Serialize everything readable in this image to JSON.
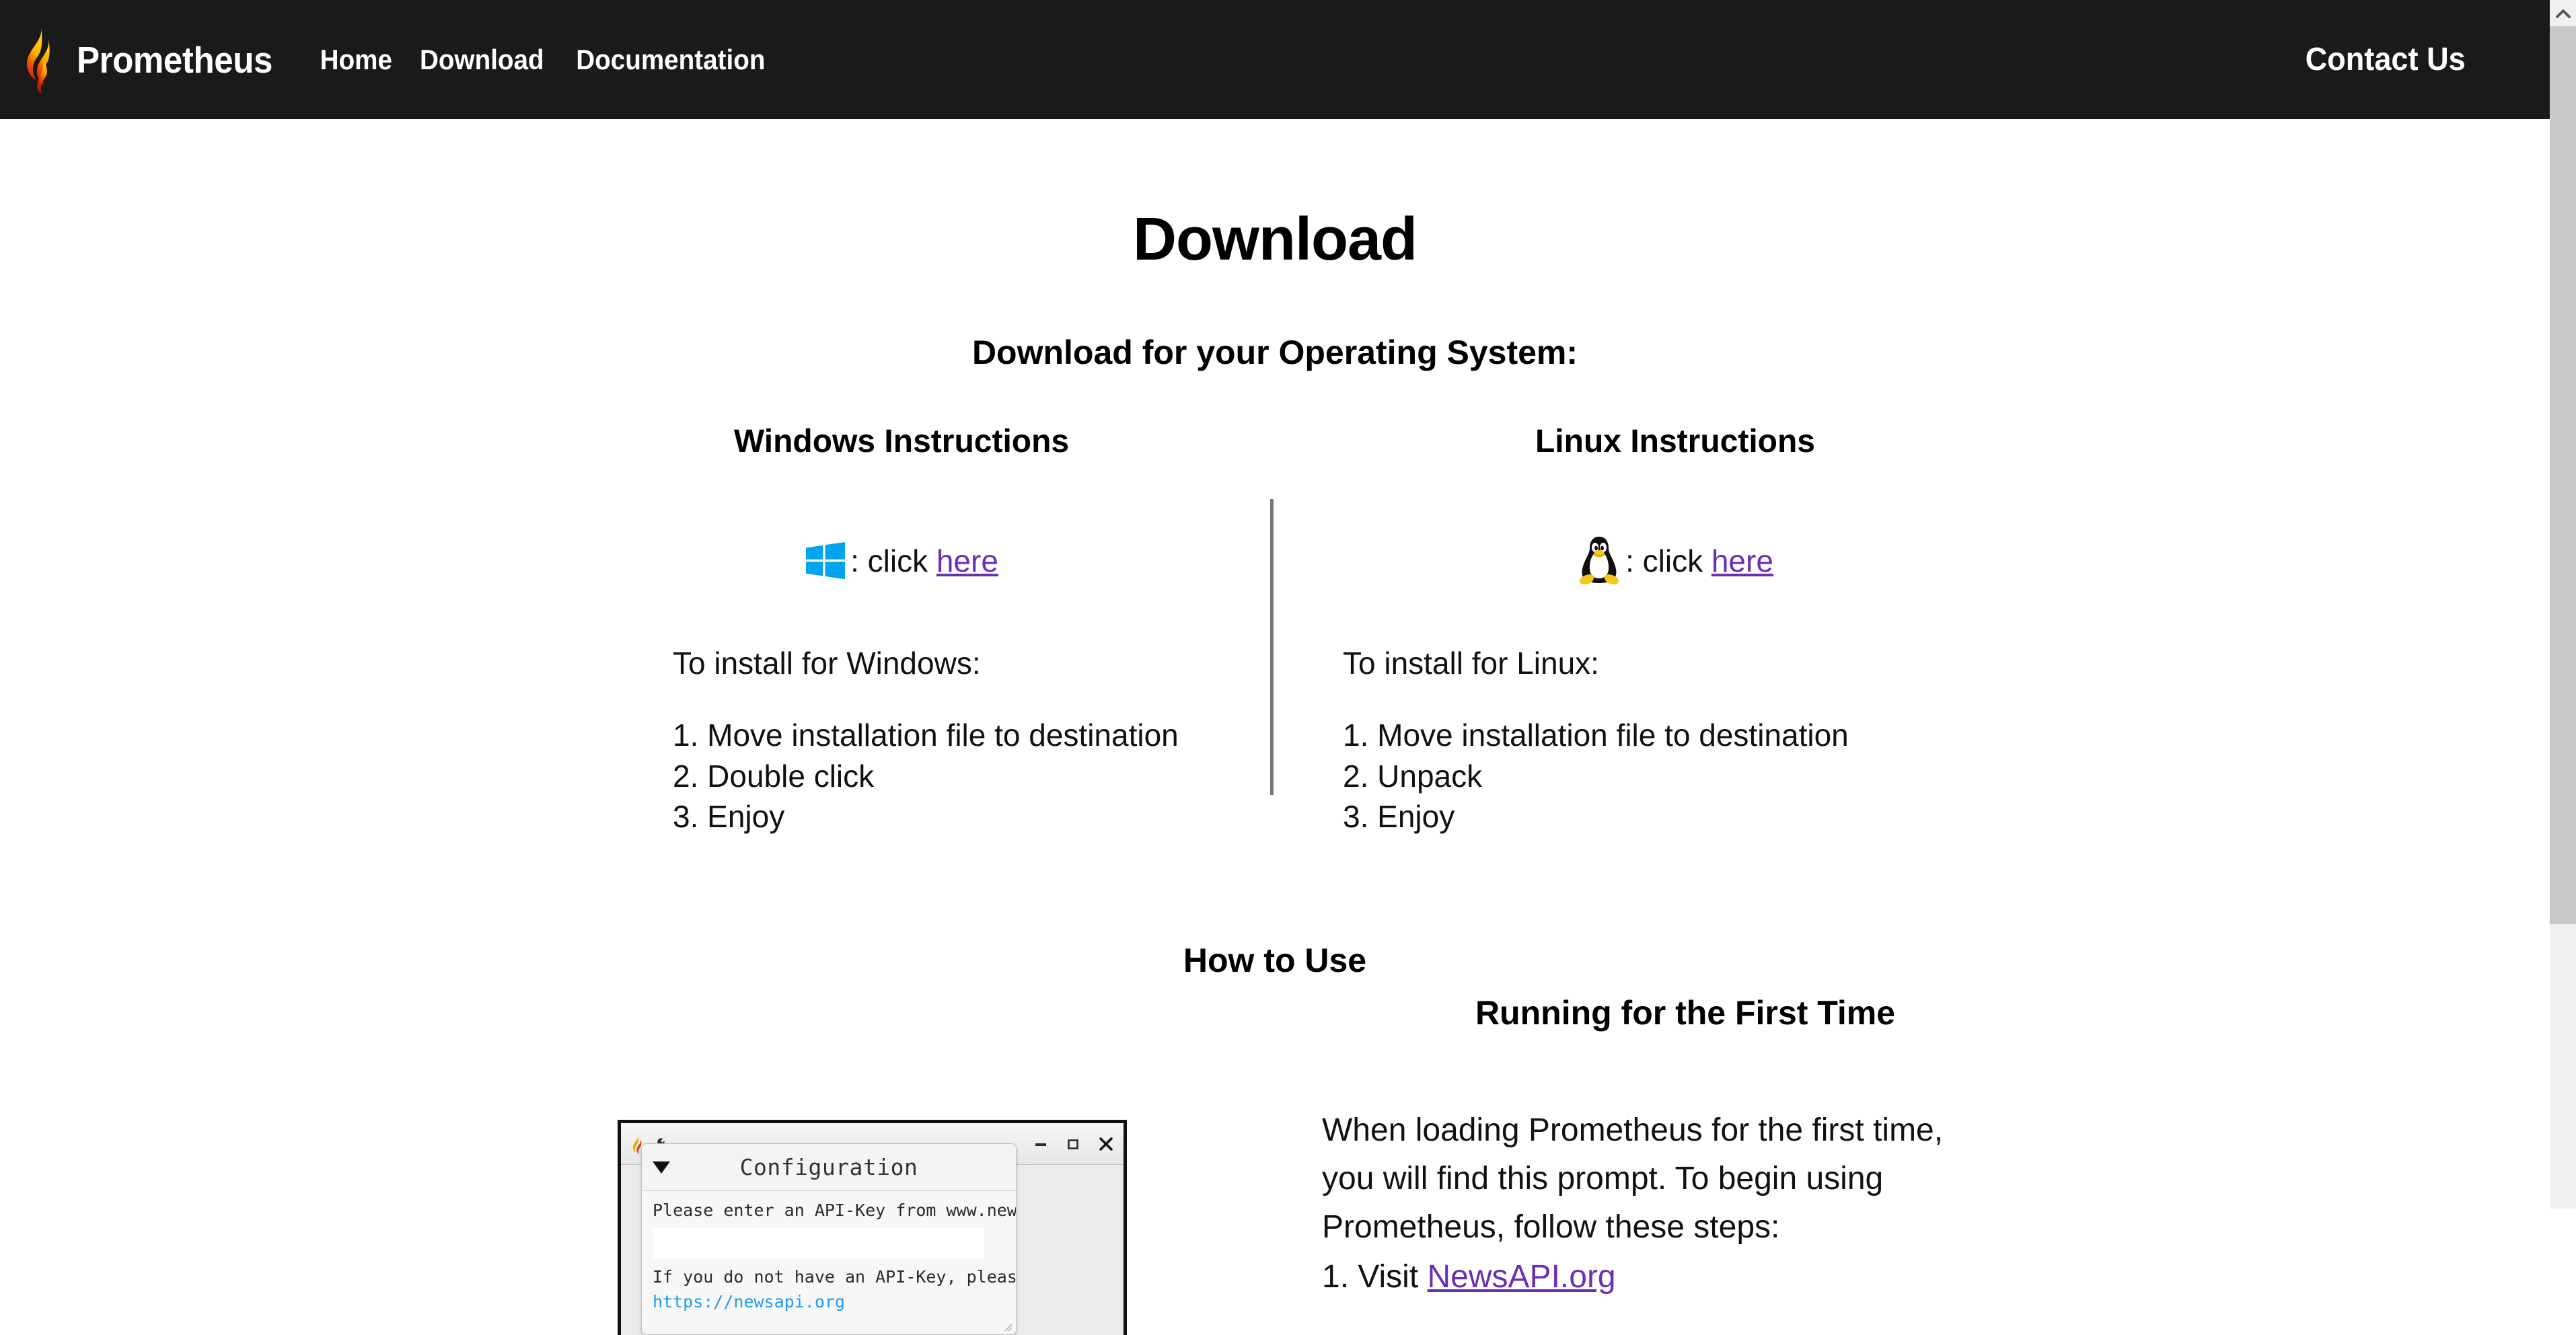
{
  "header": {
    "brand": "Prometheus",
    "logo_icon": "prometheus-flame-icon",
    "nav": [
      {
        "label": "Home"
      },
      {
        "label": "Download"
      },
      {
        "label": "Documentation"
      }
    ],
    "contact": "Contact Us"
  },
  "scrollbar": {
    "up_arrow_icon": "chevron-up-icon"
  },
  "page": {
    "title": "Download",
    "os_subtitle": "Download for your Operating System:"
  },
  "windows": {
    "heading": "Windows Instructions",
    "icon": "windows-logo-icon",
    "click_prefix": ": click ",
    "click_link": "here",
    "lead": "To install for Windows:",
    "steps": [
      "1. Move installation file to destination",
      "2. Double click",
      "3. Enjoy"
    ]
  },
  "linux": {
    "heading": "Linux Instructions",
    "icon": "linux-tux-penguin-icon",
    "click_prefix": ": click ",
    "click_link": "here",
    "lead": "To install for Linux:",
    "steps": [
      "1. Move installation file to destination",
      "2. Unpack",
      "3. Enjoy"
    ]
  },
  "howto": {
    "heading": "How to Use"
  },
  "app_window": {
    "app_icon": "prometheus-flame-icon",
    "tool_icon": "wrench-icon",
    "minimize_icon": "minimize-icon",
    "maximize_icon": "maximize-icon",
    "close_icon": "close-icon",
    "dialog": {
      "menu_arrow_icon": "caret-down-icon",
      "title": "Configuration",
      "prompt": "Please enter an API-Key from www.newsapi.org",
      "apikey_value": "",
      "apikey_placeholder": "",
      "secondary_text": "If you do not have an API-Key, please visit",
      "url_text": "https://newsapi.org",
      "resize_grip_icon": "resize-grip-icon"
    }
  },
  "firstrun": {
    "heading": "Running for the First Time",
    "paragraph_lines": [
      "When loading Prometheus for the first time,",
      "you will find this prompt.  To begin using",
      "Prometheus, follow these steps:"
    ],
    "step_clipped_prefix": "1. Visit ",
    "step_clipped_link": "NewsAPI.org"
  },
  "colors": {
    "header_bg": "#1a1a1a",
    "page_bg": "#ffffff",
    "link_purple": "#6a2fb5",
    "windows_blue": "#00a4ef",
    "url_blue": "#1e9cf0",
    "divider_gray": "#787878",
    "scrollbar_track": "#f0f0f0",
    "scrollbar_thumb": "#c9c9c9"
  }
}
